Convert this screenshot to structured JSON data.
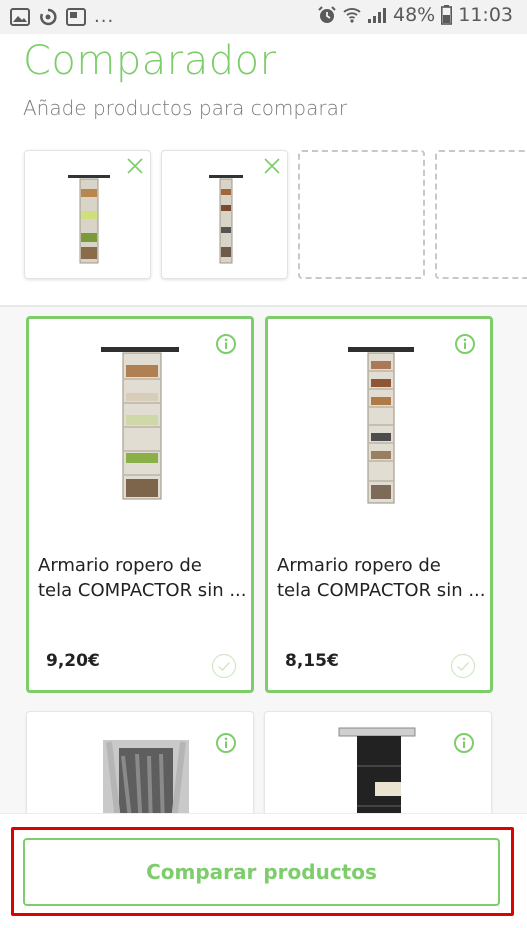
{
  "status_bar": {
    "overflow": "...",
    "battery": "48%",
    "time": "11:03"
  },
  "header": {
    "title": "Comparador",
    "subtitle": "Añade productos para comparar"
  },
  "compare_slots": [
    {
      "state": "filled"
    },
    {
      "state": "filled"
    },
    {
      "state": "empty"
    },
    {
      "state": "empty"
    }
  ],
  "products": [
    {
      "name_line1": "Armario ropero de",
      "name_line2": "tela COMPACTOR sin ...",
      "price": "9,20€",
      "selected": true
    },
    {
      "name_line1": "Armario ropero de",
      "name_line2": "tela COMPACTOR sin ...",
      "price": "8,15€",
      "selected": true
    },
    {
      "selected": false
    },
    {
      "selected": false
    }
  ],
  "actions": {
    "compare_label": "Comparar productos"
  },
  "colors": {
    "accent": "#7dcd6b",
    "highlight": "#e00000"
  },
  "icons": [
    "image-icon",
    "sync-icon",
    "picture-in-picture-icon",
    "alarm-icon",
    "wifi-icon",
    "signal-icon",
    "battery-icon",
    "close-icon",
    "info-icon",
    "check-circle-icon"
  ]
}
